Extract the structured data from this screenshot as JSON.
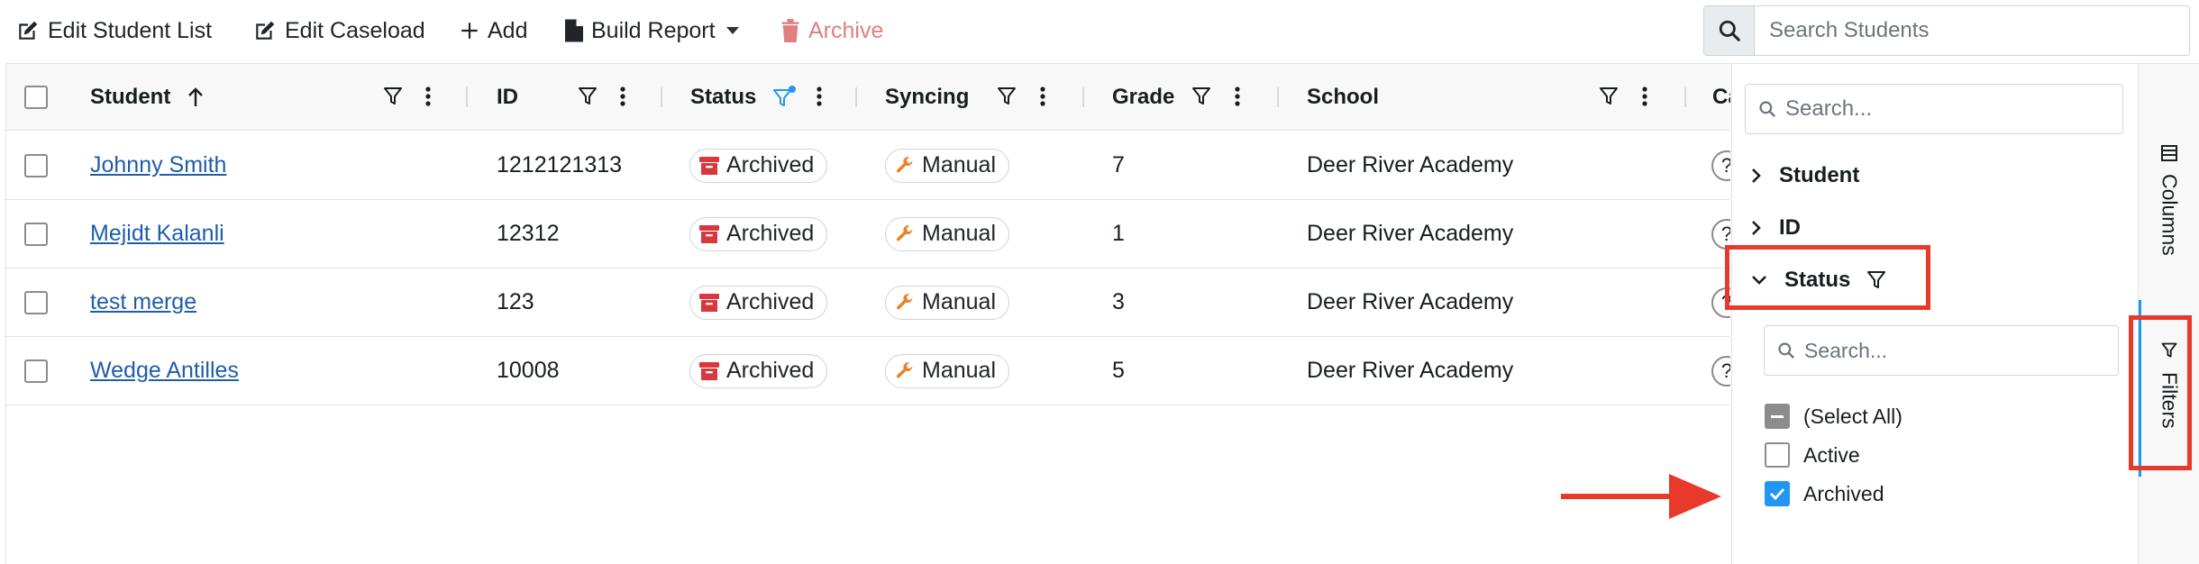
{
  "toolbar": {
    "edit_student_list": "Edit Student List",
    "edit_caseload": "Edit Caseload",
    "add": "Add",
    "build_report": "Build Report",
    "archive": "Archive"
  },
  "search": {
    "placeholder": "Search Students"
  },
  "grid": {
    "columns": [
      "Student",
      "ID",
      "Status",
      "Syncing",
      "Grade",
      "School",
      "Ca"
    ],
    "rows": [
      {
        "student": "Johnny Smith",
        "id": "1212121313",
        "status": "Archived",
        "syncing": "Manual",
        "grade": "7",
        "school": "Deer River Academy",
        "extra": "?"
      },
      {
        "student": "Mejidt Kalanli",
        "id": "12312",
        "status": "Archived",
        "syncing": "Manual",
        "grade": "1",
        "school": "Deer River Academy",
        "extra": "?"
      },
      {
        "student": "test merge",
        "id": "123",
        "status": "Archived",
        "syncing": "Manual",
        "grade": "3",
        "school": "Deer River Academy",
        "extra": "?"
      },
      {
        "student": "Wedge Antilles",
        "id": "10008",
        "status": "Archived",
        "syncing": "Manual",
        "grade": "5",
        "school": "Deer River Academy",
        "extra": "?"
      }
    ]
  },
  "filter_panel": {
    "search_placeholder": "Search...",
    "groups": [
      "Student",
      "ID",
      "Status"
    ],
    "status_filter": {
      "search_placeholder": "Search...",
      "options": [
        {
          "label": "(Select All)",
          "state": "indeterminate"
        },
        {
          "label": "Active",
          "state": "unchecked"
        },
        {
          "label": "Archived",
          "state": "checked"
        }
      ]
    }
  },
  "side_tabs": {
    "columns": "Columns",
    "filters": "Filters"
  },
  "colors": {
    "accent": "#2196f3",
    "archived_red": "#d9363e",
    "wrench_orange": "#e8832a",
    "highlight_red": "#e8392a",
    "link_blue": "#1f5ea8"
  },
  "icons": [
    "edit-icon",
    "plus-icon",
    "file-icon",
    "trash-icon",
    "search-icon",
    "sort-up-icon",
    "filter-icon",
    "menu-dots-icon",
    "archive-box-icon",
    "wrench-icon",
    "chevron-right-icon",
    "chevron-down-icon",
    "columns-icon"
  ]
}
